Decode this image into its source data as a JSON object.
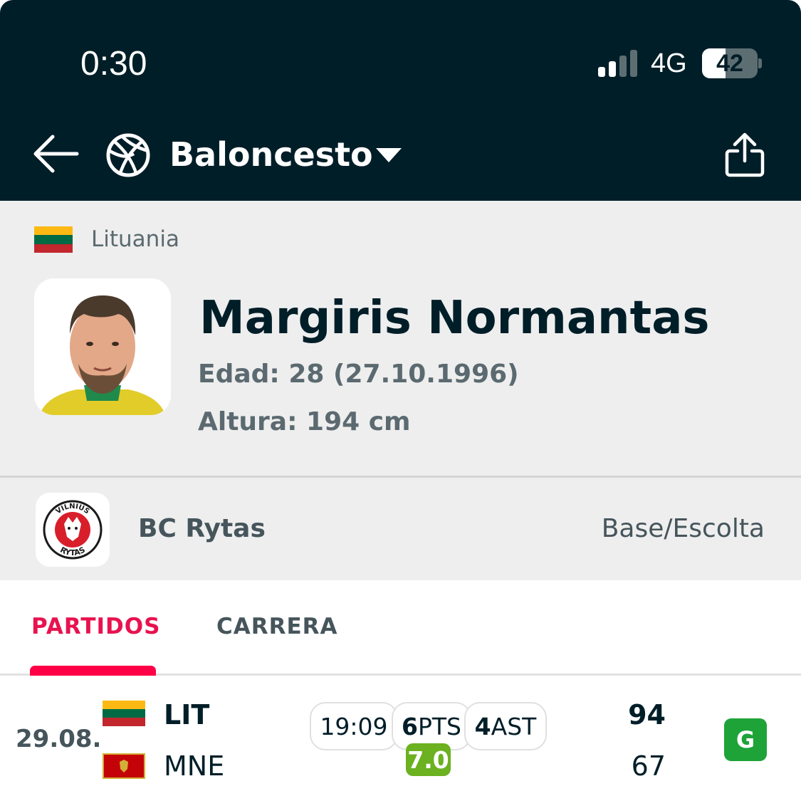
{
  "status_bar": {
    "time": "0:30",
    "network": "4G",
    "battery": "42",
    "battery_level": 0.42,
    "signal_bars_active": 2,
    "signal_bars_total": 4
  },
  "header": {
    "back_icon": "arrow-left-icon",
    "sport_icon": "basketball-icon",
    "sport_name": "Baloncesto",
    "dropdown_icon": "caret-down-icon",
    "share_icon": "share-icon"
  },
  "player": {
    "country": "Lituania",
    "name": "Margiris Normantas",
    "age": "Edad: 28 (27.10.1996)",
    "height": "Altura: 194 cm"
  },
  "team": {
    "name": "BC Rytas",
    "position": "Base/Escolta",
    "logo_text_top": "VILNIUS",
    "logo_text_bottom": "RYTAS"
  },
  "tabs": [
    {
      "label": "PARTIDOS",
      "active": true
    },
    {
      "label": "CARRERA",
      "active": false
    }
  ],
  "matches": [
    {
      "date": "29.08.",
      "home": {
        "code": "LIT",
        "score": "94"
      },
      "away": {
        "code": "MNE",
        "score": "67"
      },
      "minutes": "19:09",
      "pts_value": "6",
      "pts_label": "PTS",
      "ast_value": "4",
      "ast_label": "AST",
      "rating": "7.0",
      "result": "G"
    }
  ],
  "colors": {
    "header_bg": "#001e28",
    "accent": "#ff0046",
    "rating_bg": "#6bb120",
    "win_bg": "#1ea339"
  }
}
